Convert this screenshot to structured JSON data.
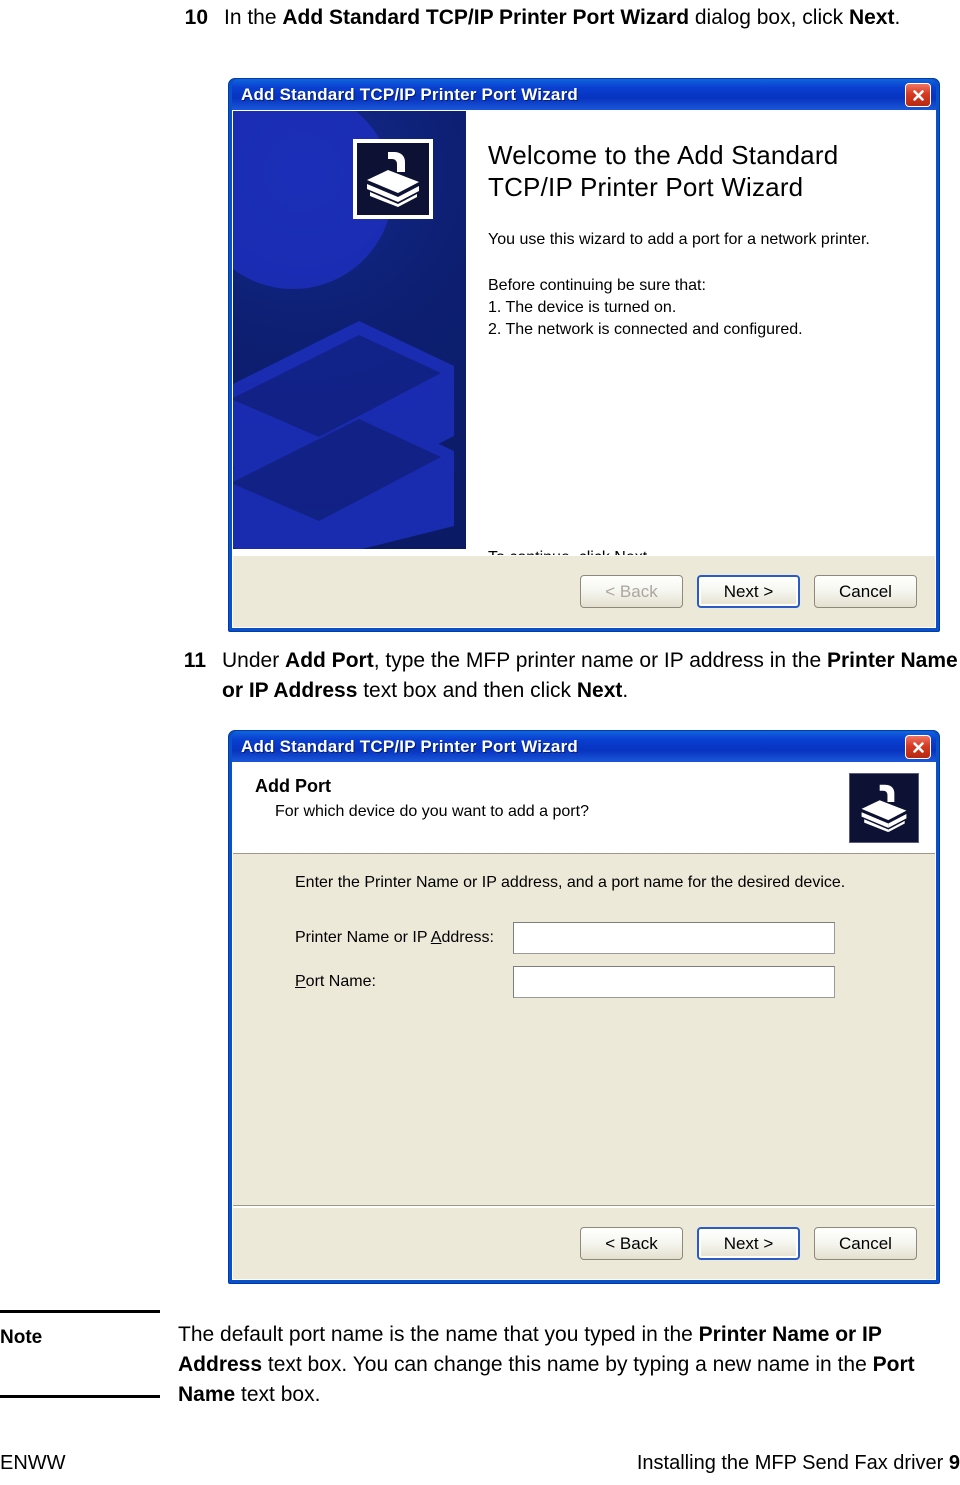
{
  "steps": [
    {
      "number": "10",
      "parts": [
        {
          "t": "In the ",
          "b": false
        },
        {
          "t": "Add Standard TCP/IP Printer Port Wizard",
          "b": true
        },
        {
          "t": " dialog box, click ",
          "b": false
        },
        {
          "t": "Next",
          "b": true
        },
        {
          "t": ".",
          "b": false
        }
      ]
    },
    {
      "number": "11",
      "parts": [
        {
          "t": "Under ",
          "b": false
        },
        {
          "t": "Add Port",
          "b": true
        },
        {
          "t": ", type the MFP printer name or IP address in the ",
          "b": false
        },
        {
          "t": "Printer Name or IP Address",
          "b": true
        },
        {
          "t": " text box and then click ",
          "b": false
        },
        {
          "t": "Next",
          "b": true
        },
        {
          "t": ".",
          "b": false
        }
      ]
    }
  ],
  "dialog1": {
    "title": "Add Standard TCP/IP Printer Port Wizard",
    "close_icon": "close-icon",
    "banner_icon": "printer-icon",
    "heading": "Welcome to the Add Standard\nTCP/IP Printer Port Wizard",
    "intro": "You use this wizard to add a port for a network printer.",
    "before_label": "Before continuing be sure that:",
    "list": [
      "1.  The device is turned on.",
      "2.  The network is connected and configured."
    ],
    "continue_text": "To continue, click Next.",
    "buttons": {
      "back": "< Back",
      "back_accel": "B",
      "next": "Next >",
      "next_accel": "N",
      "cancel": "Cancel",
      "back_disabled": "true",
      "next_default": "true"
    }
  },
  "dialog2": {
    "title": "Add Standard TCP/IP Printer Port Wizard",
    "close_icon": "close-icon",
    "header_icon": "printer-icon",
    "header_title": "Add Port",
    "header_sub": "For which device do you want to add a port?",
    "form_intro": "Enter the Printer Name or IP address, and a port name for the desired device.",
    "fields": [
      {
        "label_pre": "Printer Name or IP ",
        "label_accel": "A",
        "label_post": "ddress:",
        "value": "",
        "placeholder": ""
      },
      {
        "label_pre": "",
        "label_accel": "P",
        "label_post": "ort Name:",
        "value": "",
        "placeholder": ""
      }
    ],
    "buttons": {
      "back": "< Back",
      "back_accel": "B",
      "next": "Next >",
      "next_accel": "N",
      "cancel": "Cancel",
      "back_disabled": "false",
      "next_default": "true"
    }
  },
  "note": {
    "label": "Note",
    "parts": [
      {
        "t": "The default port name is the name that you typed in the ",
        "b": false
      },
      {
        "t": "Printer Name or IP Address",
        "b": true
      },
      {
        "t": " text box. You can change this name by typing a new name in the ",
        "b": false
      },
      {
        "t": "Port Name",
        "b": true
      },
      {
        "t": " text box.",
        "b": false
      }
    ]
  },
  "footer": {
    "left": "ENWW",
    "right_text": "Installing the MFP Send Fax driver ",
    "page_number": "9"
  },
  "colors": {
    "titlebar_blue": "#0A3FD0",
    "dialog_face": "#ECE9D8",
    "banner_navy": "#0B1A63",
    "close_red": "#D63A22",
    "default_btn_border": "#2B5CC6"
  }
}
